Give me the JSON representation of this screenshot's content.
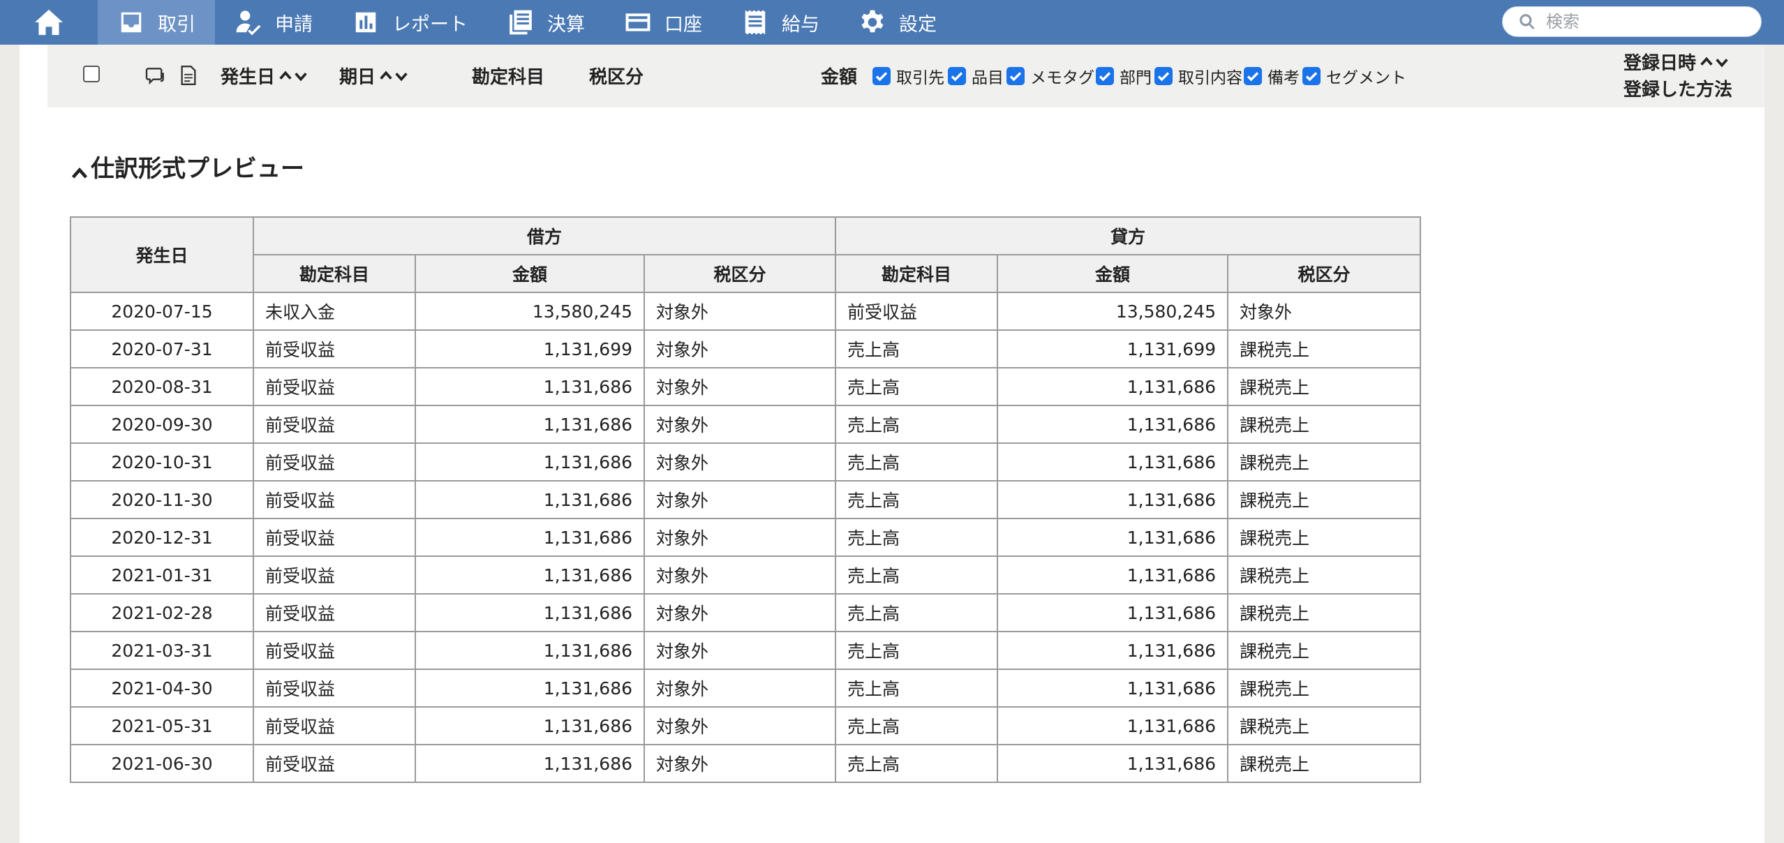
{
  "nav": {
    "items": [
      {
        "label": "取引",
        "icon": "inbox-icon",
        "active": true
      },
      {
        "label": "申請",
        "icon": "user-check-icon",
        "active": false
      },
      {
        "label": "レポート",
        "icon": "bar-chart-icon",
        "active": false
      },
      {
        "label": "決算",
        "icon": "document-stack-icon",
        "active": false
      },
      {
        "label": "口座",
        "icon": "credit-card-icon",
        "active": false
      },
      {
        "label": "給与",
        "icon": "receipt-icon",
        "active": false
      },
      {
        "label": "設定",
        "icon": "gear-icon",
        "active": false
      }
    ],
    "search_placeholder": "検索"
  },
  "columns_bar": {
    "issue_date": "発生日",
    "due_date": "期日",
    "account": "勘定科目",
    "tax": "税区分",
    "amount": "金額",
    "options": [
      "取引先",
      "品目",
      "メモタグ",
      "部門",
      "取引内容",
      "備考",
      "セグメント"
    ],
    "registered_at": "登録日時",
    "registered_method": "登録した方法"
  },
  "preview": {
    "title": "仕訳形式プレビュー",
    "headers": {
      "date": "発生日",
      "debit": "借方",
      "credit": "貸方",
      "account": "勘定科目",
      "amount": "金額",
      "tax": "税区分"
    },
    "rows": [
      {
        "date": "2020-07-15",
        "debit_account": "未収入金",
        "debit_amount": "13,580,245",
        "debit_tax": "対象外",
        "credit_account": "前受収益",
        "credit_amount": "13,580,245",
        "credit_tax": "対象外"
      },
      {
        "date": "2020-07-31",
        "debit_account": "前受収益",
        "debit_amount": "1,131,699",
        "debit_tax": "対象外",
        "credit_account": "売上高",
        "credit_amount": "1,131,699",
        "credit_tax": "課税売上"
      },
      {
        "date": "2020-08-31",
        "debit_account": "前受収益",
        "debit_amount": "1,131,686",
        "debit_tax": "対象外",
        "credit_account": "売上高",
        "credit_amount": "1,131,686",
        "credit_tax": "課税売上"
      },
      {
        "date": "2020-09-30",
        "debit_account": "前受収益",
        "debit_amount": "1,131,686",
        "debit_tax": "対象外",
        "credit_account": "売上高",
        "credit_amount": "1,131,686",
        "credit_tax": "課税売上"
      },
      {
        "date": "2020-10-31",
        "debit_account": "前受収益",
        "debit_amount": "1,131,686",
        "debit_tax": "対象外",
        "credit_account": "売上高",
        "credit_amount": "1,131,686",
        "credit_tax": "課税売上"
      },
      {
        "date": "2020-11-30",
        "debit_account": "前受収益",
        "debit_amount": "1,131,686",
        "debit_tax": "対象外",
        "credit_account": "売上高",
        "credit_amount": "1,131,686",
        "credit_tax": "課税売上"
      },
      {
        "date": "2020-12-31",
        "debit_account": "前受収益",
        "debit_amount": "1,131,686",
        "debit_tax": "対象外",
        "credit_account": "売上高",
        "credit_amount": "1,131,686",
        "credit_tax": "課税売上"
      },
      {
        "date": "2021-01-31",
        "debit_account": "前受収益",
        "debit_amount": "1,131,686",
        "debit_tax": "対象外",
        "credit_account": "売上高",
        "credit_amount": "1,131,686",
        "credit_tax": "課税売上"
      },
      {
        "date": "2021-02-28",
        "debit_account": "前受収益",
        "debit_amount": "1,131,686",
        "debit_tax": "対象外",
        "credit_account": "売上高",
        "credit_amount": "1,131,686",
        "credit_tax": "課税売上"
      },
      {
        "date": "2021-03-31",
        "debit_account": "前受収益",
        "debit_amount": "1,131,686",
        "debit_tax": "対象外",
        "credit_account": "売上高",
        "credit_amount": "1,131,686",
        "credit_tax": "課税売上"
      },
      {
        "date": "2021-04-30",
        "debit_account": "前受収益",
        "debit_amount": "1,131,686",
        "debit_tax": "対象外",
        "credit_account": "売上高",
        "credit_amount": "1,131,686",
        "credit_tax": "課税売上"
      },
      {
        "date": "2021-05-31",
        "debit_account": "前受収益",
        "debit_amount": "1,131,686",
        "debit_tax": "対象外",
        "credit_account": "売上高",
        "credit_amount": "1,131,686",
        "credit_tax": "課税売上"
      },
      {
        "date": "2021-06-30",
        "debit_account": "前受収益",
        "debit_amount": "1,131,686",
        "debit_tax": "対象外",
        "credit_account": "売上高",
        "credit_amount": "1,131,686",
        "credit_tax": "課税売上"
      }
    ]
  },
  "colors": {
    "nav_bg": "#4b79b4",
    "nav_active": "#6d93c6",
    "checkbox_blue": "#1a73e8"
  }
}
